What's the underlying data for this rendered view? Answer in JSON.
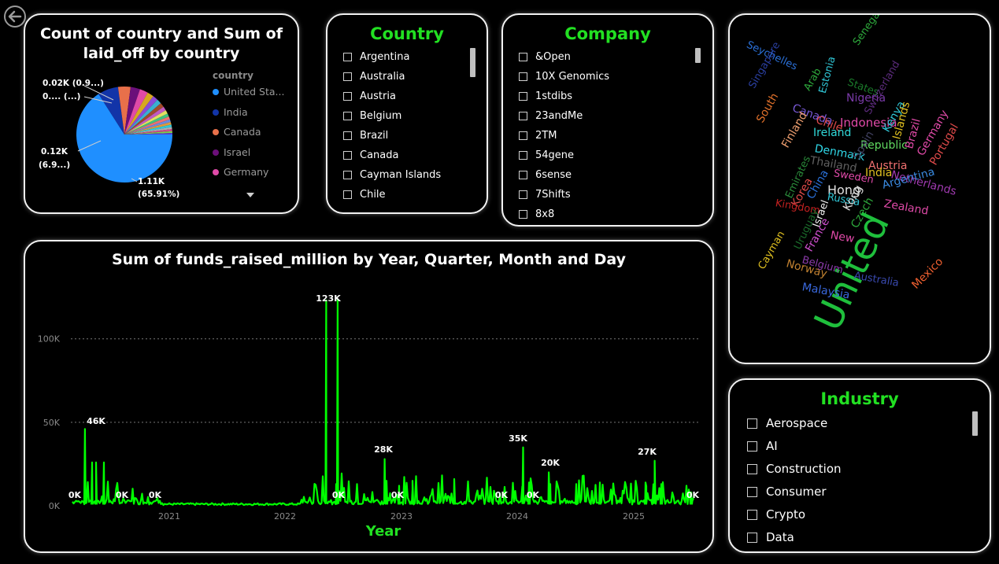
{
  "pie_card": {
    "title_line1": "Count of country and Sum of",
    "title_line2": "laid_off by country",
    "legend_title": "country",
    "legend": [
      {
        "label": "United Sta...",
        "color": "#1f8fff"
      },
      {
        "label": "India",
        "color": "#1234a8"
      },
      {
        "label": "Canada",
        "color": "#e8704a"
      },
      {
        "label": "Israel",
        "color": "#6b0f7a"
      },
      {
        "label": "Germany",
        "color": "#e04aa8"
      }
    ],
    "labels": {
      "l1": "0.02K (0.9...)",
      "l2": "0.... (...)",
      "l3a": "0.12K",
      "l3b": "(6.9...)",
      "l4a": "1.11K",
      "l4b": "(65.91%)"
    }
  },
  "country_slicer": {
    "title": "Country",
    "options": [
      "Argentina",
      "Australia",
      "Austria",
      "Belgium",
      "Brazil",
      "Canada",
      "Cayman Islands",
      "Chile"
    ]
  },
  "company_slicer": {
    "title": "Company",
    "options": [
      "&Open",
      "10X Genomics",
      "1stdibs",
      "23andMe",
      "2TM",
      "54gene",
      "6sense",
      "7Shifts",
      "8x8"
    ]
  },
  "industry_slicer": {
    "title": "Industry",
    "options": [
      "Aerospace",
      "AI",
      "Construction",
      "Consumer",
      "Crypto",
      "Data"
    ]
  },
  "wordcloud": {
    "words": [
      {
        "text": "Seychelles",
        "color": "#2a6fd6"
      },
      {
        "text": "Senegal",
        "color": "#2eaa3c"
      },
      {
        "text": "Singapore",
        "color": "#2a3fa0"
      },
      {
        "text": "Arab",
        "color": "#2eaa3c"
      },
      {
        "text": "Estonia",
        "color": "#30c8d8"
      },
      {
        "text": "States",
        "color": "#1a7a2a"
      },
      {
        "text": "Nigeria",
        "color": "#7a3aa8"
      },
      {
        "text": "Switzerland",
        "color": "#5a2a7a"
      },
      {
        "text": "South",
        "color": "#e0702a"
      },
      {
        "text": "Canada",
        "color": "#7a5ad8"
      },
      {
        "text": "Indonesia",
        "color": "#e04aa8"
      },
      {
        "text": "Kenya",
        "color": "#30c8d8"
      },
      {
        "text": "Islands",
        "color": "#e0c020"
      },
      {
        "text": "Finland",
        "color": "#f0a070"
      },
      {
        "text": "Chile",
        "color": "#e04a4a"
      },
      {
        "text": "Brazil",
        "color": "#e04aa8"
      },
      {
        "text": "Germany",
        "color": "#e04aa8"
      },
      {
        "text": "Ireland",
        "color": "#30d8d8"
      },
      {
        "text": "Republic",
        "color": "#60d860"
      },
      {
        "text": "Portugal",
        "color": "#e04a4a"
      },
      {
        "text": "Denmark",
        "color": "#30d8e8"
      },
      {
        "text": "Thailand",
        "color": "#606060"
      },
      {
        "text": "Spain",
        "color": "#404060"
      },
      {
        "text": "Austria",
        "color": "#f07070"
      },
      {
        "text": "Emirates",
        "color": "#2a8a3a"
      },
      {
        "text": "Sweden",
        "color": "#e04aa8"
      },
      {
        "text": "India",
        "color": "#e0c020"
      },
      {
        "text": "Netherlands",
        "color": "#a03ab0"
      },
      {
        "text": "Korea",
        "color": "#e04a4a"
      },
      {
        "text": "China",
        "color": "#2a6fd6"
      },
      {
        "text": "Hong",
        "color": "#e0e0e0"
      },
      {
        "text": "Argentina",
        "color": "#3a8ae0"
      },
      {
        "text": "Russia",
        "color": "#30c8d8"
      },
      {
        "text": "Kong",
        "color": "#e0e0e0"
      },
      {
        "text": "Zealand",
        "color": "#e04aa8"
      },
      {
        "text": "Kingdom",
        "color": "#c02020"
      },
      {
        "text": "Czech",
        "color": "#2eaa3c"
      },
      {
        "text": "United",
        "color": "#1fbf3c"
      },
      {
        "text": "Uruguay",
        "color": "#1a6a2a"
      },
      {
        "text": "Israel",
        "color": "#f0f0f0"
      },
      {
        "text": "France",
        "color": "#d050d0"
      },
      {
        "text": "New",
        "color": "#e04aa8"
      },
      {
        "text": "Cayman",
        "color": "#e0c020"
      },
      {
        "text": "Norway",
        "color": "#c08030"
      },
      {
        "text": "Belgium",
        "color": "#8a3aa8"
      },
      {
        "text": "Australia",
        "color": "#3a4ab0"
      },
      {
        "text": "Mexico",
        "color": "#f06030"
      },
      {
        "text": "Malaysia",
        "color": "#3a6ae0"
      }
    ]
  },
  "line_card": {
    "title": "Sum of funds_raised_million by Year, Quarter, Month and Day",
    "xlabel": "Year",
    "x_ticks": [
      "2021",
      "2022",
      "2023",
      "2024",
      "2025"
    ],
    "y_ticks": [
      "0K",
      "50K",
      "100K"
    ],
    "data_labels": [
      "0K",
      "46K",
      "0K",
      "0K",
      "123K",
      "0K",
      "28K",
      "0K",
      "35K",
      "0K",
      "0K",
      "20K",
      "27K",
      "0K"
    ]
  },
  "chart_data": {
    "type": "line",
    "title": "Sum of funds_raised_million by Year, Quarter, Month and Day",
    "xlabel": "Year",
    "ylabel": "",
    "ylim": [
      0,
      130000
    ],
    "x_ticks": [
      "2021",
      "2022",
      "2023",
      "2024",
      "2025"
    ],
    "series": [
      {
        "color": "#00ff00",
        "peaks": [
          {
            "date": "2020-04-10",
            "value": 46000
          },
          {
            "date": "2022-05-10",
            "value": 123000
          },
          {
            "date": "2022-06-15",
            "value": 123000
          },
          {
            "date": "2022-11-10",
            "value": 28000
          },
          {
            "date": "2024-01-20",
            "value": 35000
          },
          {
            "date": "2024-04-10",
            "value": 20000
          },
          {
            "date": "2025-03-10",
            "value": 27000
          }
        ]
      }
    ],
    "grid": true
  }
}
